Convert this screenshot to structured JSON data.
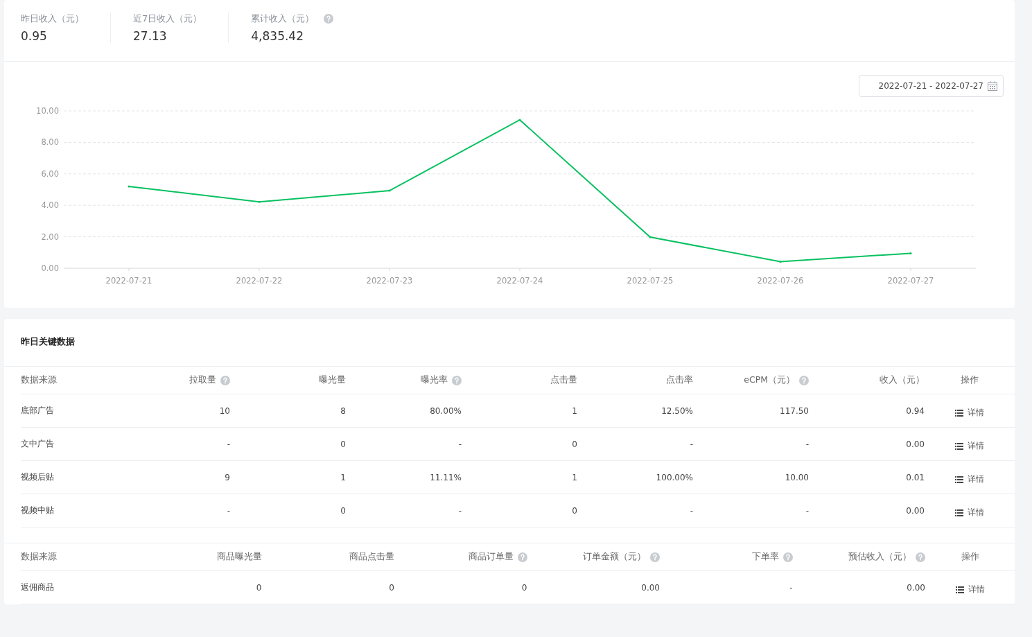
{
  "stats": [
    {
      "label": "昨日收入（元）",
      "value": "0.95",
      "help": false
    },
    {
      "label": "近7日收入（元）",
      "value": "27.13",
      "help": false
    },
    {
      "label": "累计收入（元）",
      "value": "4,835.42",
      "help": true
    }
  ],
  "date_range": "2022-07-21 - 2022-07-27",
  "chart_data": {
    "type": "line",
    "categories": [
      "2022-07-21",
      "2022-07-22",
      "2022-07-23",
      "2022-07-24",
      "2022-07-25",
      "2022-07-26",
      "2022-07-27"
    ],
    "series": [
      {
        "color": "#07c160",
        "values": [
          5.2,
          4.22,
          4.93,
          9.43,
          1.98,
          0.42,
          0.95
        ]
      }
    ],
    "ylim": [
      0,
      10
    ],
    "grid": true,
    "yticks": [
      {
        "value": 0,
        "label": "0.00"
      },
      {
        "value": 2,
        "label": "2.00"
      },
      {
        "value": 4,
        "label": "4.00"
      },
      {
        "value": 6,
        "label": "6.00"
      },
      {
        "value": 8,
        "label": "8.00"
      },
      {
        "value": 10,
        "label": "10.00"
      }
    ]
  },
  "key_data": {
    "title": "昨日关键数据",
    "tables": [
      {
        "columns": [
          {
            "label": "数据来源",
            "help": false
          },
          {
            "label": "拉取量",
            "help": true
          },
          {
            "label": "曝光量",
            "help": false
          },
          {
            "label": "曝光率",
            "help": true
          },
          {
            "label": "点击量",
            "help": false
          },
          {
            "label": "点击率",
            "help": false
          },
          {
            "label": "eCPM（元）",
            "help": true
          },
          {
            "label": "收入（元）",
            "help": false
          },
          {
            "label": "操作",
            "help": false
          }
        ],
        "rows": [
          {
            "cells": [
              "底部广告",
              "10",
              "8",
              "80.00%",
              "1",
              "12.50%",
              "117.50",
              "0.94"
            ],
            "action": "详情"
          },
          {
            "cells": [
              "文中广告",
              "-",
              "0",
              "-",
              "0",
              "-",
              "-",
              "0.00"
            ],
            "action": "详情"
          },
          {
            "cells": [
              "视频后贴",
              "9",
              "1",
              "11.11%",
              "1",
              "100.00%",
              "10.00",
              "0.01"
            ],
            "action": "详情"
          },
          {
            "cells": [
              "视频中贴",
              "-",
              "0",
              "-",
              "0",
              "-",
              "-",
              "0.00"
            ],
            "action": "详情"
          }
        ]
      },
      {
        "columns": [
          {
            "label": "数据来源",
            "help": false
          },
          {
            "label": "商品曝光量",
            "help": false
          },
          {
            "label": "商品点击量",
            "help": false
          },
          {
            "label": "商品订单量",
            "help": true
          },
          {
            "label": "订单金额（元）",
            "help": true
          },
          {
            "label": "下单率",
            "help": true
          },
          {
            "label": "预估收入（元）",
            "help": true
          },
          {
            "label": "操作",
            "help": false
          }
        ],
        "rows": [
          {
            "cells": [
              "返佣商品",
              "0",
              "0",
              "0",
              "0.00",
              "-",
              "0.00"
            ],
            "action": "详情"
          }
        ]
      }
    ]
  }
}
